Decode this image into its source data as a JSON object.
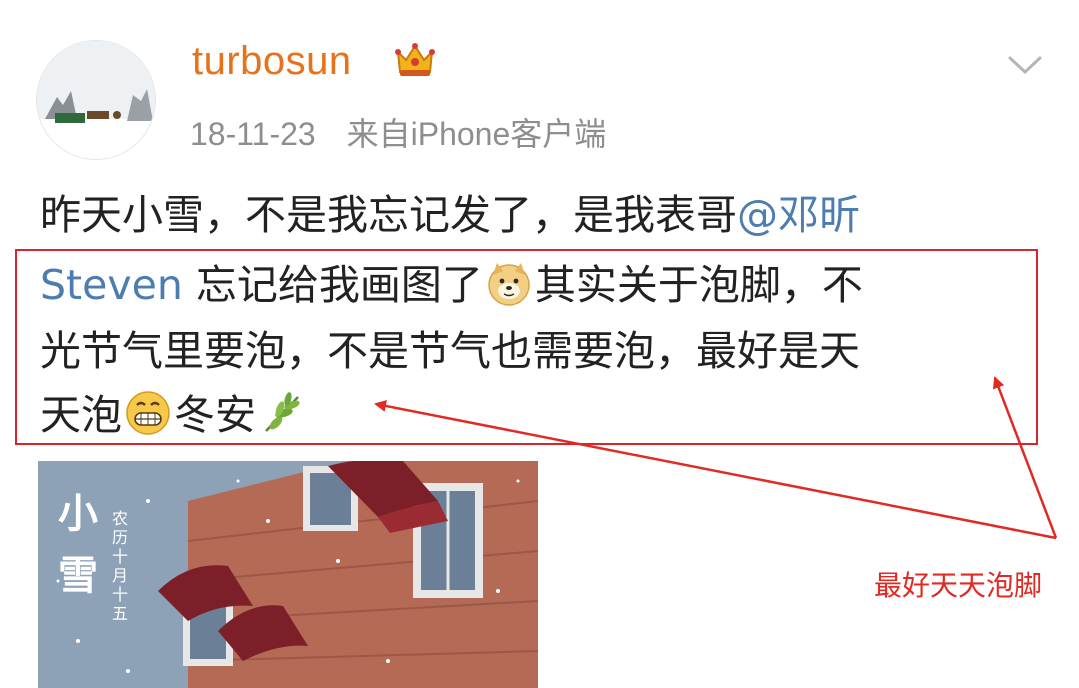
{
  "post": {
    "username": "turbosun",
    "date": "18-11-23",
    "source": "来自iPhone客户端",
    "text": {
      "line1_a": "昨天小雪，不是我忘记发了，是我表哥",
      "line1_mention": "@邓昕",
      "line2_mention": "Steven",
      "line2_a": " 忘记给我画图了",
      "line2_b": "其实关于泡脚，不",
      "line3": "光节气里要泡，不是节气也需要泡，最好是天",
      "line4_a": "天泡",
      "line4_b": "冬安"
    }
  },
  "poster": {
    "title1": "小",
    "title2": "雪",
    "subtitle": "农历十月十五"
  },
  "annotation": {
    "label": "最好天天泡脚",
    "color": "#e02a23"
  },
  "icons": {
    "crown": "crown-icon",
    "menu": "chevron-down-icon",
    "doge": "doge-emoji-icon",
    "grin": "grin-emoji-icon",
    "leaf": "leaf-emoji-icon"
  },
  "colors": {
    "username": "#e8721c",
    "mention": "#4c7cb0",
    "meta": "#8e8e8e"
  }
}
